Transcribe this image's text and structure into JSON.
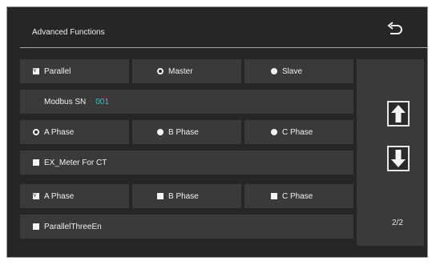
{
  "header": {
    "title": "Advanced Functions",
    "back_icon": "return-arrow-icon"
  },
  "rows": {
    "parallel": {
      "label": "Parallel",
      "checked": true
    },
    "master": {
      "label": "Master",
      "selected": true
    },
    "slave": {
      "label": "Slave",
      "selected": false
    },
    "modbus": {
      "label": "Modbus SN",
      "value": "001"
    },
    "phase_a": {
      "label": "A Phase",
      "selected": true
    },
    "phase_b": {
      "label": "B Phase",
      "selected": false
    },
    "phase_c": {
      "label": "C Phase",
      "selected": false
    },
    "ex_meter": {
      "label": "EX_Meter For CT",
      "checked": false
    },
    "ct_a": {
      "label": "A Phase",
      "checked": true
    },
    "ct_b": {
      "label": "B Phase",
      "checked": false
    },
    "ct_c": {
      "label": "C Phase",
      "checked": false
    },
    "three_en": {
      "label": "ParallelThreeEn",
      "checked": false
    }
  },
  "sidebar": {
    "up_icon": "arrow-up-icon",
    "down_icon": "arrow-down-icon",
    "page": "2/2"
  },
  "colors": {
    "background": "#262626",
    "cell": "#3a3a3a",
    "accent": "#35c0c8",
    "text": "#f0f0f0"
  }
}
